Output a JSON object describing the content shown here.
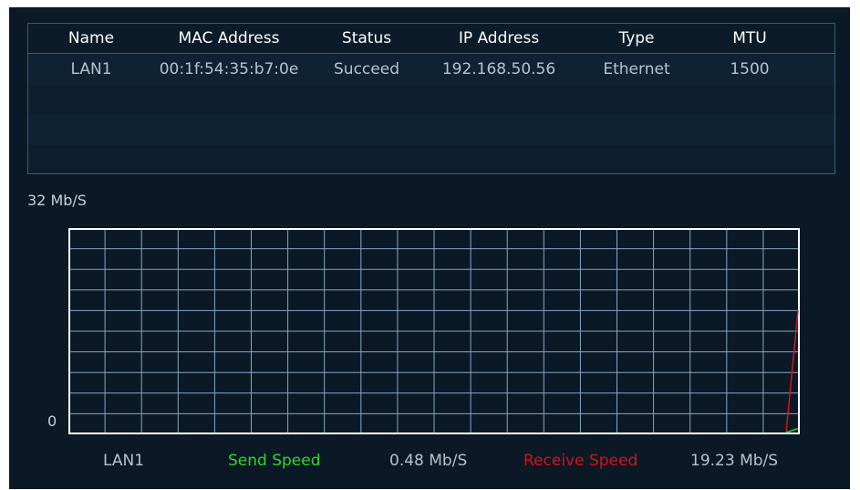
{
  "table": {
    "headers": [
      "Name",
      "MAC Address",
      "Status",
      "IP Address",
      "Type",
      "MTU"
    ],
    "rows": [
      [
        "LAN1",
        "00:1f:54:35:b7:0e",
        "Succeed",
        "192.168.50.56",
        "Ethernet",
        "1500"
      ]
    ]
  },
  "graph": {
    "y_max_label": "32 Mb/S",
    "y_min_label": "0",
    "send_color": "#2fd62f",
    "receive_color": "#d8121a",
    "grid_color": "#8aa4c8",
    "border_color": "#ffffff",
    "send_level_fraction": 0.015,
    "receive_level_fraction": 0.601
  },
  "legend": {
    "interface": "LAN1",
    "send_label": "Send Speed",
    "send_value": "0.48 Mb/S",
    "receive_label": "Receive Speed",
    "receive_value": "19.23 Mb/S"
  }
}
